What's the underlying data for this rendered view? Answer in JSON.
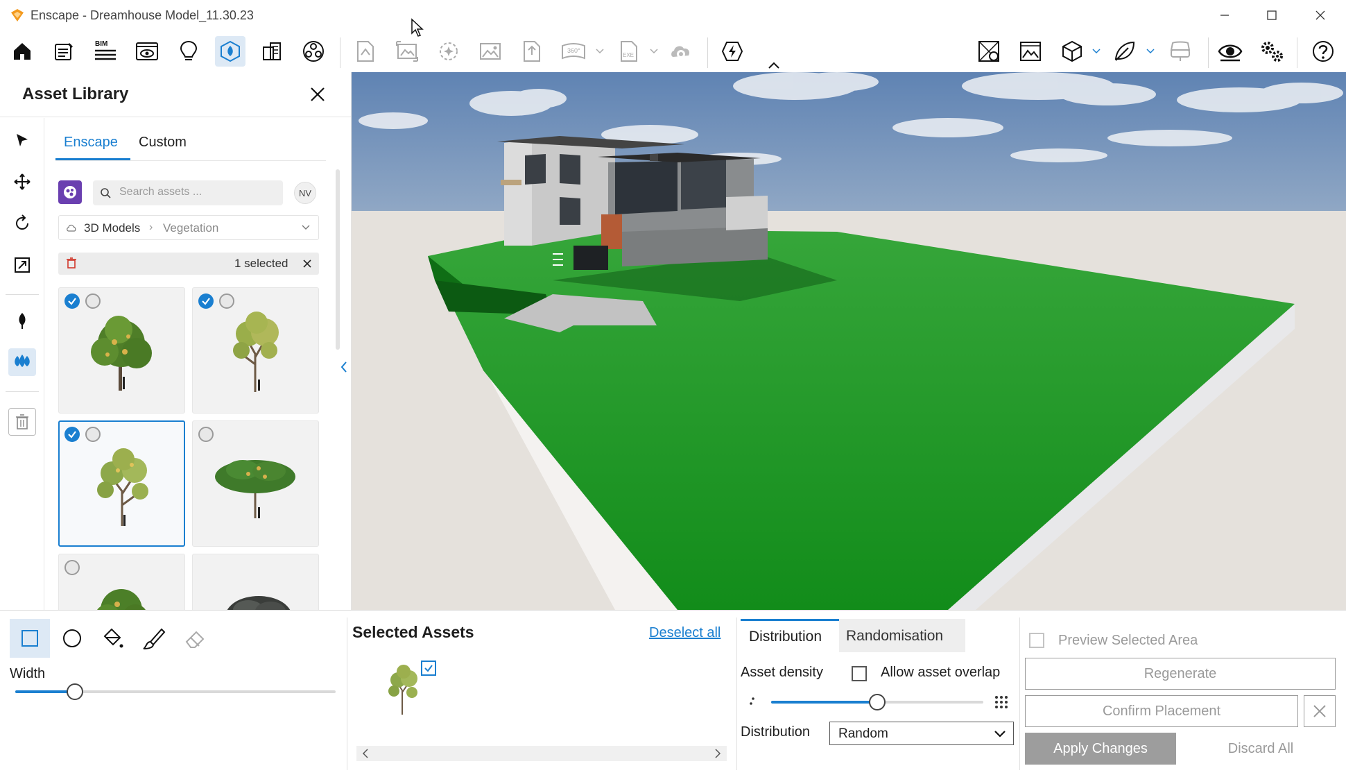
{
  "window": {
    "title": "Enscape - Dreamhouse Model_11.30.23",
    "minimize_icon": "minimize-icon",
    "maximize_icon": "maximize-icon",
    "close_icon": "close-icon"
  },
  "toolbar": {
    "bim_label": "BIM",
    "exe_label": "EXE",
    "pano_label": "360°"
  },
  "asset_library": {
    "title": "Asset Library",
    "tabs": [
      {
        "label": "Enscape",
        "active": true
      },
      {
        "label": "Custom",
        "active": false
      }
    ],
    "search_placeholder": "Search assets ...",
    "user_badge": "NV",
    "breadcrumb": {
      "root": "3D Models",
      "current": "Vegetation"
    },
    "selection_text": "1 selected",
    "accent_color": "#1a7fd0"
  },
  "tools": {
    "width_label": "Width",
    "width_value": 0.18
  },
  "selected_assets": {
    "title": "Selected Assets",
    "deselect_all": "Deselect all"
  },
  "distribution": {
    "tabs": [
      {
        "label": "Distribution",
        "active": true
      },
      {
        "label": "Randomisation",
        "active": false
      }
    ],
    "asset_density_label": "Asset density",
    "allow_overlap_label": "Allow asset overlap",
    "density_value": 0.5,
    "distribution_label": "Distribution",
    "distribution_value": "Random"
  },
  "actions": {
    "preview_label": "Preview Selected Area",
    "regenerate": "Regenerate",
    "confirm_placement": "Confirm Placement",
    "apply_changes": "Apply Changes",
    "discard_all": "Discard All"
  }
}
